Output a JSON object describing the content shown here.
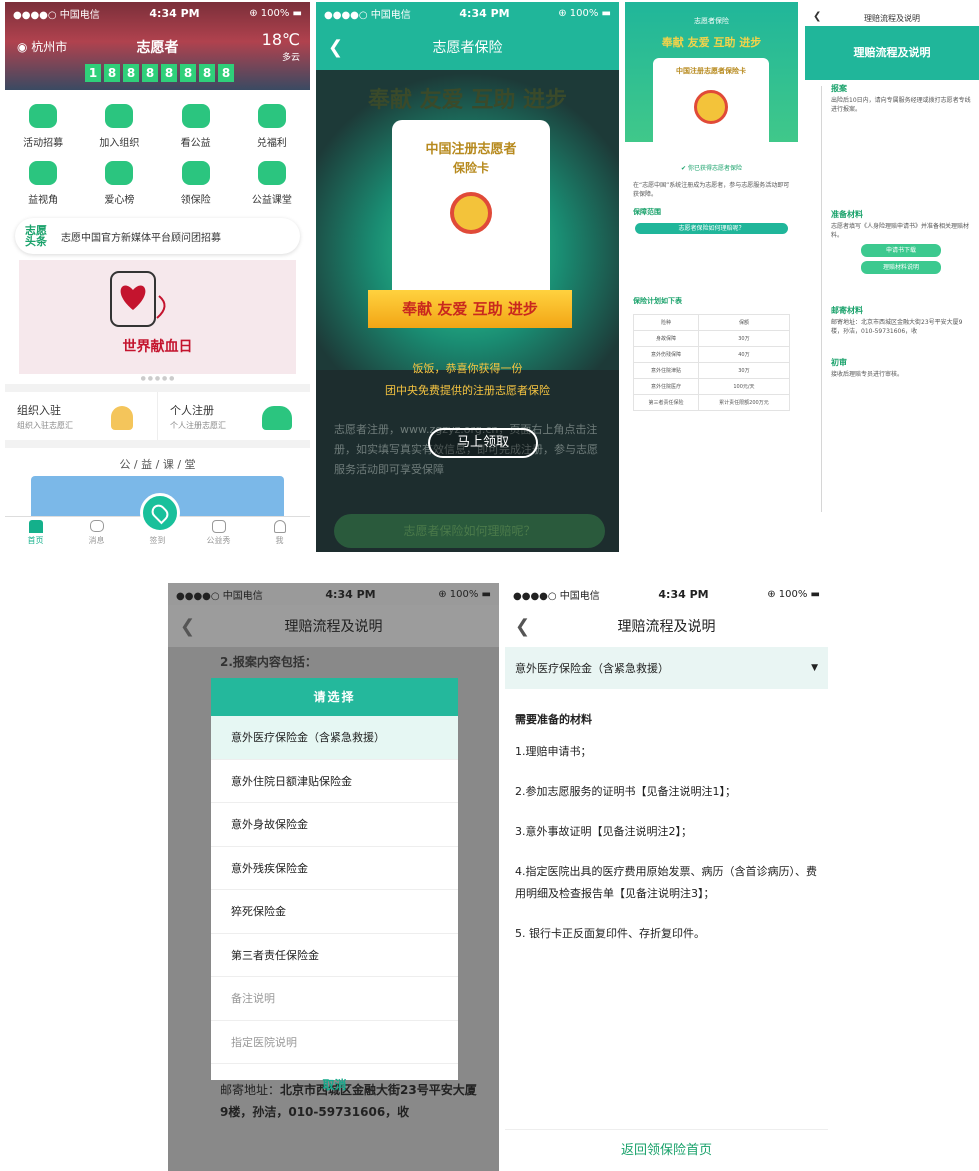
{
  "status": {
    "carrier": "●●●●○ 中国电信",
    "time": "4:34 PM",
    "battery": "100%"
  },
  "home": {
    "city": "杭州市",
    "title": "志愿者",
    "temp": "18℃",
    "condition": "多云",
    "counter_digits": [
      "1",
      "8",
      "8",
      "8",
      "8",
      "8",
      "8",
      "8"
    ],
    "grid": [
      {
        "label": "活动招募",
        "icon": "recruit-icon",
        "color": "#2bc57f"
      },
      {
        "label": "加入组织",
        "icon": "handshake-icon",
        "color": "#2bc57f"
      },
      {
        "label": "看公益",
        "icon": "watch-icon",
        "color": "#2bc57f"
      },
      {
        "label": "兑福利",
        "icon": "gift-icon",
        "color": "#2bc57f"
      },
      {
        "label": "益视角",
        "icon": "camera-icon",
        "color": "#2bc57f"
      },
      {
        "label": "爱心榜",
        "icon": "ranking-icon",
        "color": "#2bc57f"
      },
      {
        "label": "领保险",
        "icon": "insurance-icon",
        "color": "#2bc57f"
      },
      {
        "label": "公益课堂",
        "icon": "classroom-icon",
        "color": "#2bc57f"
      }
    ],
    "news_tag": "志愿头条",
    "news_text": "志愿中国官方新媒体平台顾问团招募",
    "banner_title": "世界献血日",
    "org_title": "组织入驻",
    "org_sub": "组织入驻志愿汇",
    "person_title": "个人注册",
    "person_sub": "个人注册志愿汇",
    "course_heading": "公 / 益 / 课 / 堂",
    "tabs": [
      "首页",
      "消息",
      "签到",
      "公益秀",
      "我"
    ]
  },
  "insurance": {
    "nav_title": "志愿者保险",
    "slogan": "奉献 友爱 互助 进步",
    "card_title1": "中国注册志愿者",
    "card_title2": "保险卡",
    "msg1": "饭饭，恭喜你获得一份",
    "msg2": "团中央免费提供的注册志愿者保险",
    "body": "志愿者注册，www.zgzyz.org.cn，页面右上角点击注册，如实填写真实有效信息，即可完成注册，参与志愿服务活动即可享受保障",
    "claim_button": "马上领取",
    "bottom_button": "志愿者保险如何理赔呢？"
  },
  "card_detail": {
    "nav_title": "志愿者保险",
    "slogan": "奉献 友爱 互助 进步",
    "card_title": "中国注册志愿者保险卡",
    "got": "你已获得志愿者保险",
    "intro": "在“志愿中国”系统注册成为志愿者，参与志愿服务活动即可获保障。",
    "sec1": "保障范围",
    "pill": "志愿者保险如何理赔呢？",
    "sec2": "保险计划如下表",
    "table_head": [
      "险种",
      "保额"
    ],
    "table_rows": [
      [
        "身故保障",
        "30万"
      ],
      [
        "意外伤残保障",
        "40万"
      ],
      [
        "意外住院津贴",
        "30万"
      ],
      [
        "意外住院医疗",
        "100元/天"
      ],
      [
        "第三者责任保险",
        "累计责任限额200万元"
      ]
    ]
  },
  "claim_flow": {
    "nav_title": "理赔流程及说明",
    "hero": "理赔流程及说明",
    "step1": "报案",
    "step1_text": "出险后10日内，请向专属服务经理或拨打志愿者专线进行报案。",
    "step2": "准备材料",
    "step2_text": "志愿者填写《人身险理赔申请书》并准备相关理赔材料。",
    "btn1": "申请书下载",
    "btn2": "理赔材料说明",
    "step3": "邮寄材料",
    "step3_text": "邮寄地址：北京市西城区金融大街23号平安大厦9楼，孙洁，010-59731606，收",
    "step4": "初审",
    "step4_text": "接收后理赔专员进行审核。"
  },
  "picker": {
    "nav_title": "理赔流程及说明",
    "header": "请选择",
    "behind_header": "2.报案内容包括：",
    "options": [
      "意外医疗保险金（含紧急救援）",
      "意外住院日额津贴保险金",
      "意外身故保险金",
      "意外残疾保险金",
      "猝死保险金",
      "第三者责任保险金",
      "备注说明",
      "指定医院说明"
    ],
    "cancel": "取消",
    "addr_label": "邮寄地址：",
    "addr_value": "北京市西城区金融大街23号平安大厦9楼，孙洁，010-59731606，收"
  },
  "materials": {
    "nav_title": "理赔流程及说明",
    "selected": "意外医疗保险金（含紧急救援）",
    "title": "需要准备的材料",
    "items": [
      "1.理赔申请书；",
      "2.参加志愿服务的证明书【见备注说明注1】；",
      "3.意外事故证明【见备注说明注2】；",
      "4.指定医院出具的医疗费用原始发票、病历（含首诊病历）、费用明细及检查报告单【见备注说明注3】；",
      "5. 银行卡正反面复印件、存折复印件。"
    ],
    "footer": "返回领保险首页"
  }
}
